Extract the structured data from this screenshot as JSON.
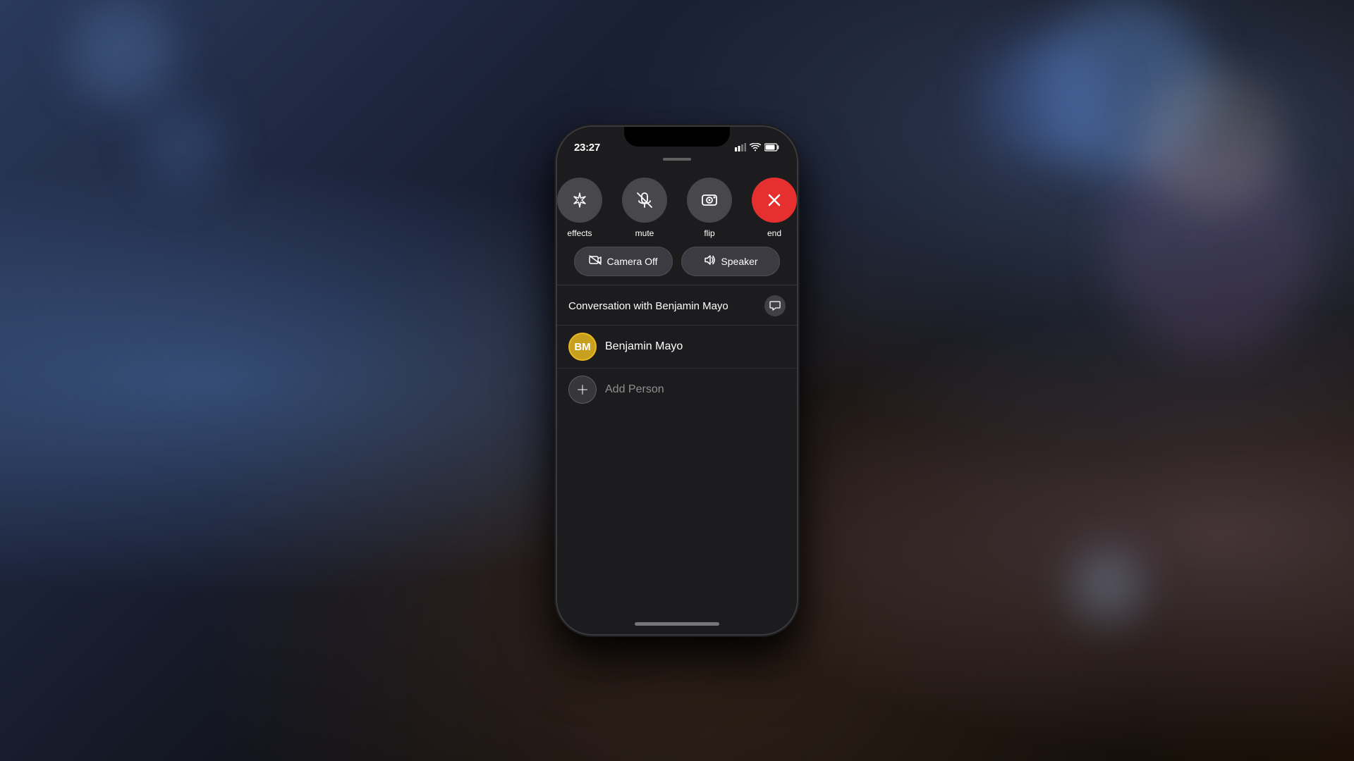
{
  "background": {
    "desc": "Bokeh photography background with wooden table"
  },
  "phone": {
    "status_bar": {
      "time": "23:27",
      "signal": "▌▌",
      "wifi": "WiFi",
      "battery": "🔋"
    },
    "call_controls": {
      "buttons": [
        {
          "id": "effects",
          "label": "effects",
          "icon": "✦",
          "type": "normal"
        },
        {
          "id": "mute",
          "label": "mute",
          "icon": "🎤",
          "type": "normal"
        },
        {
          "id": "flip",
          "label": "flip",
          "icon": "📷",
          "type": "normal"
        },
        {
          "id": "end",
          "label": "end",
          "icon": "✕",
          "type": "end"
        }
      ]
    },
    "secondary_controls": {
      "buttons": [
        {
          "id": "camera_off",
          "label": "Camera Off",
          "icon": "📷"
        },
        {
          "id": "speaker",
          "label": "Speaker",
          "icon": "🔊"
        }
      ]
    },
    "conversation": {
      "title": "Conversation with Benjamin Mayo",
      "contacts": [
        {
          "id": "benjamin_mayo",
          "initials": "BM",
          "name": "Benjamin Mayo"
        }
      ],
      "add_person_label": "Add Person"
    },
    "home_indicator": true
  }
}
